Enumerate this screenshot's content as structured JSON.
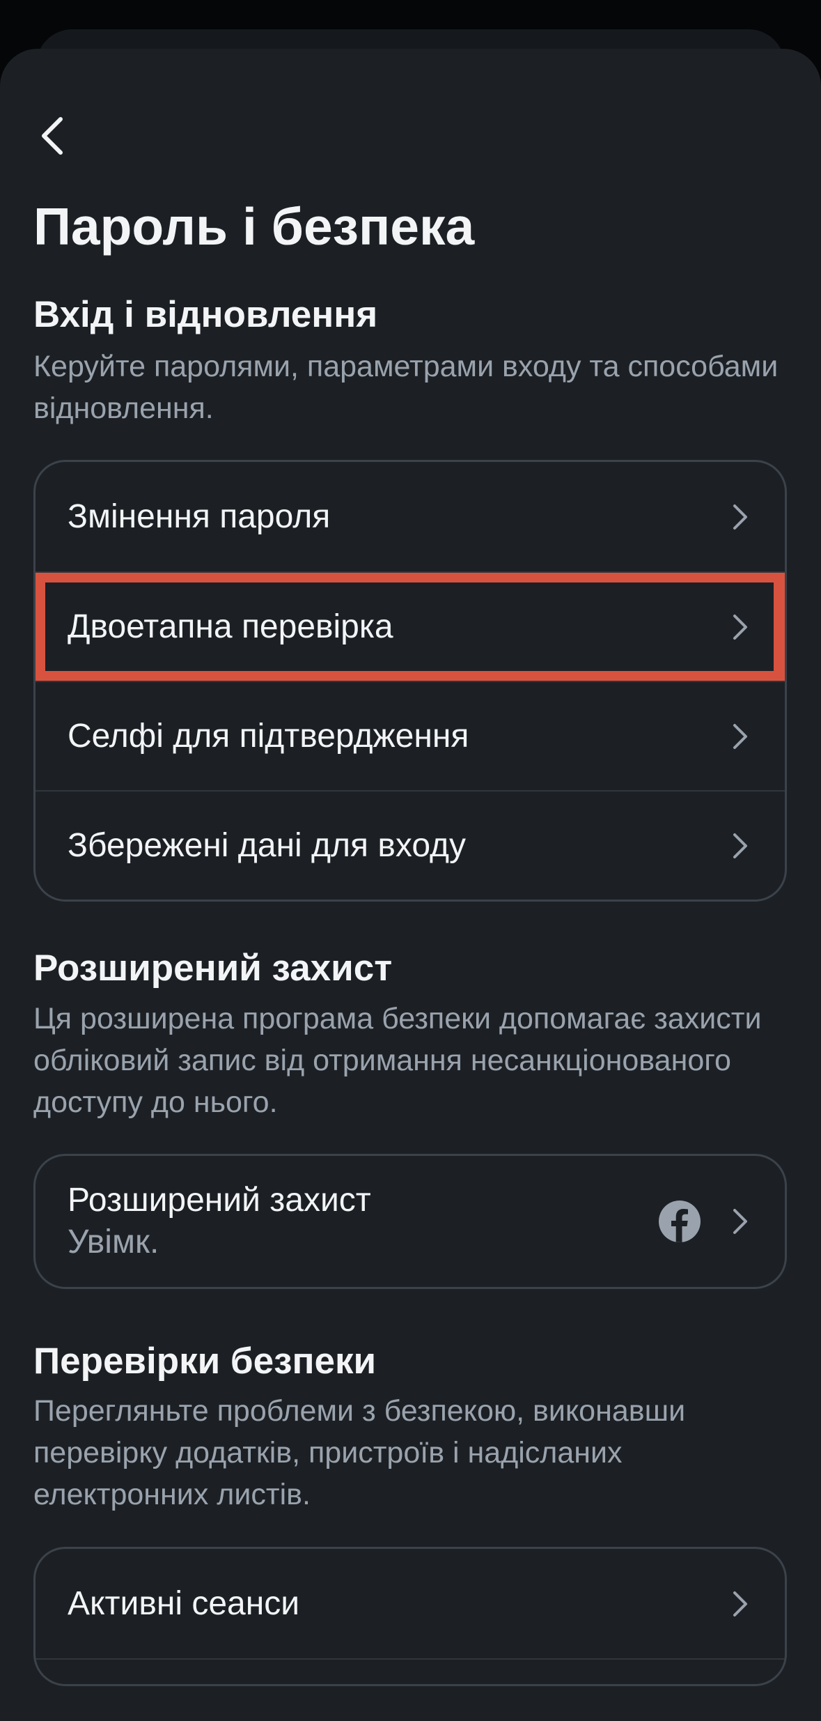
{
  "header": {
    "title": "Пароль і безпека"
  },
  "login_recovery": {
    "title": "Вхід і відновлення",
    "description": "Керуйте паролями, параметрами входу та способами відновлення.",
    "items": [
      {
        "label": "Змінення пароля"
      },
      {
        "label": "Двоетапна перевірка",
        "highlighted": true
      },
      {
        "label": "Селфі для підтвердження"
      },
      {
        "label": "Збережені дані для входу"
      }
    ]
  },
  "advanced_protection": {
    "title": "Розширений захист",
    "description": "Ця розширена програма безпеки допомагає захисти обліковий запис від отримання несанкціонованого доступу до нього.",
    "item": {
      "label": "Розширений захист",
      "status": "Увімк.",
      "icon": "facebook-icon"
    }
  },
  "security_checks": {
    "title": "Перевірки безпеки",
    "description": "Перегляньте проблеми з безпекою, виконавши перевірку додатків, пристроїв і надісланих електронних листів.",
    "items": [
      {
        "label": "Активні сеанси"
      }
    ]
  },
  "colors": {
    "background": "#1c2025",
    "highlight": "#d8533f",
    "text_primary": "#f2f4f6",
    "text_secondary": "#9aa3ad"
  }
}
